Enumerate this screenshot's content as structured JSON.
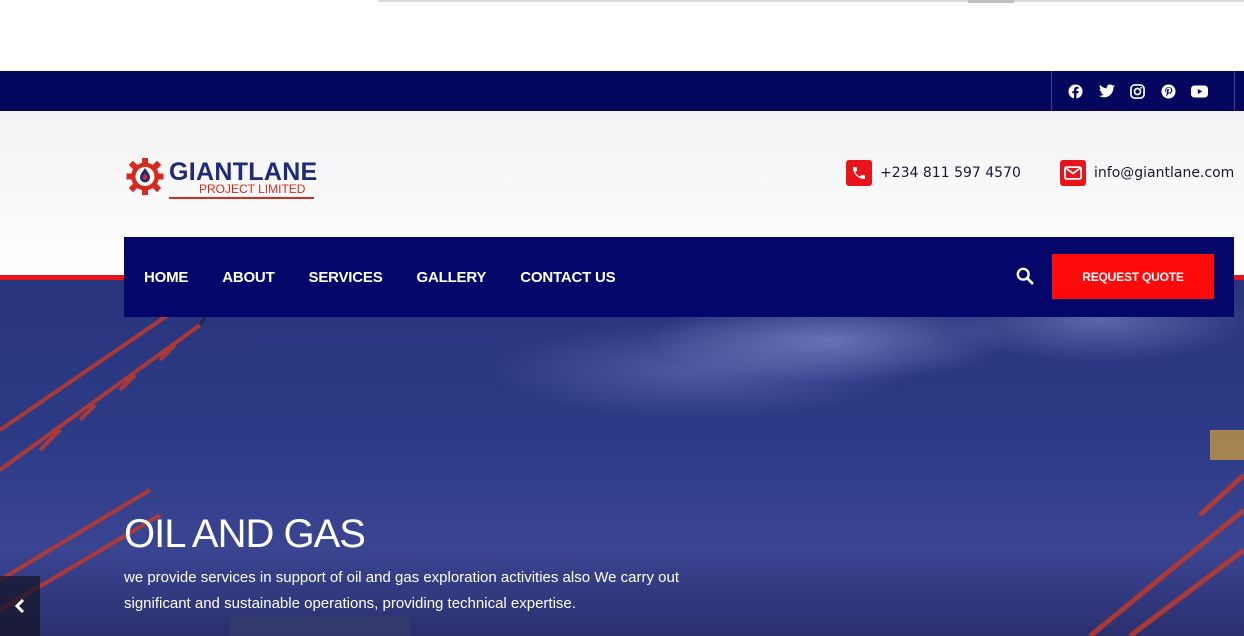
{
  "social": {
    "icons": [
      "facebook-icon",
      "twitter-icon",
      "instagram-icon",
      "pinterest-icon",
      "youtube-icon"
    ]
  },
  "brand": {
    "name": "GIANTLANE",
    "subtitle": "PROJECT LIMITED"
  },
  "contact": {
    "phone": "+234 811 597 4570",
    "email": "info@giantlane.com"
  },
  "nav": {
    "items": [
      "HOME",
      "ABOUT",
      "SERVICES",
      "GALLERY",
      "CONTACT US"
    ],
    "quote_label": "REQUEST QUOTE"
  },
  "hero": {
    "title": "OIL AND GAS",
    "text": "we provide services in support of oil and gas exploration activities also We carry out significant and sustainable operations, providing technical expertise."
  },
  "colors": {
    "navy": "#05066a",
    "topbar": "#05065e",
    "accent_red": "#e8141b",
    "button_red": "#ff0a0a"
  }
}
